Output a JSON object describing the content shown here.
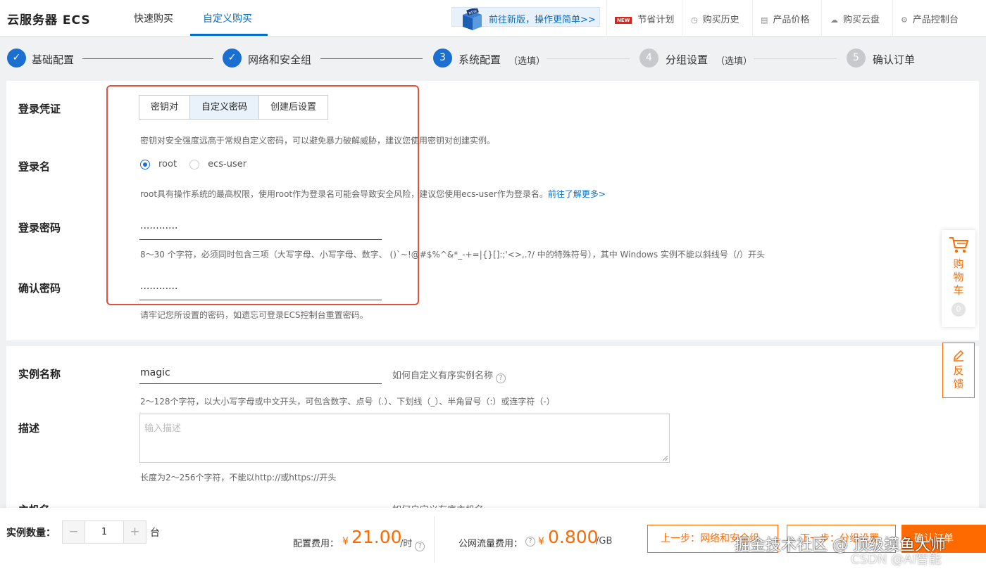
{
  "header": {
    "brand": "云服务器 ECS",
    "tabs": [
      {
        "label": "快速购买"
      },
      {
        "label": "自定义购买"
      }
    ],
    "promo": "前往新版，操作更简单>>",
    "nav": [
      {
        "label": "节省计划",
        "icon": "new-badge-icon",
        "badge": "NEW"
      },
      {
        "label": "购买历史",
        "icon": "clock-icon"
      },
      {
        "label": "产品价格",
        "icon": "document-icon"
      },
      {
        "label": "购买云盘",
        "icon": "cloud-disk-icon"
      },
      {
        "label": "产品控制台",
        "icon": "gear-icon"
      }
    ]
  },
  "steps": [
    {
      "num": "✓",
      "label": "基础配置",
      "optional": "",
      "state": "done"
    },
    {
      "num": "✓",
      "label": "网络和安全组",
      "optional": "",
      "state": "done"
    },
    {
      "num": "3",
      "label": "系统配置",
      "optional": "（选填）",
      "state": "current"
    },
    {
      "num": "4",
      "label": "分组设置",
      "optional": "（选填）",
      "state": "todo"
    },
    {
      "num": "5",
      "label": "确认订单",
      "optional": "",
      "state": "todo"
    }
  ],
  "login": {
    "credential_label": "登录凭证",
    "credential_options": [
      "密钥对",
      "自定义密码",
      "创建后设置"
    ],
    "credential_selected": "自定义密码",
    "credential_hint": "密钥对安全强度远高于常规自定义密码，可以避免暴力破解威胁，建议您使用密钥对创建实例。",
    "username_label": "登录名",
    "username_options": [
      "root",
      "ecs-user"
    ],
    "username_selected": "root",
    "username_hint": "root具有操作系统的最高权限，使用root作为登录名可能会导致安全风险，建议您使用ecs-user作为登录名。",
    "username_link": "前往了解更多>",
    "password_label": "登录密码",
    "password_value": "············",
    "password_hint": "8～30 个字符，必须同时包含三项（大写字母、小写字母、数字、 ()`~!@#$%^&*_-+=|{}[]:;'<>,.?/ 中的特殊符号），其中 Windows 实例不能以斜线号（/）开头",
    "confirm_label": "确认密码",
    "confirm_value": "············",
    "confirm_hint": "请牢记您所设置的密码，如遗忘可登录ECS控制台重置密码。"
  },
  "instance": {
    "name_label": "实例名称",
    "name_value": "magic",
    "name_help": "如何自定义有序实例名称",
    "name_hint": "2～128个字符，以大小写字母或中文开头，可包含数字、点号（.）、下划线（_）、半角冒号（:）或连字符（-）",
    "desc_label": "描述",
    "desc_placeholder": "输入描述",
    "desc_hint": "长度为2～256个字符，不能以http://或https://开头",
    "host_label_partial": "主机名",
    "host_help_partial": "如何自定义有序主机名"
  },
  "side": {
    "cart_chars": [
      "购",
      "物",
      "车"
    ],
    "cart_count": "0",
    "feedback_chars": [
      "反",
      "馈"
    ]
  },
  "footer": {
    "qty_label": "实例数量：",
    "qty_value": "1",
    "qty_minus": "−",
    "qty_plus": "+",
    "qty_unit": "台",
    "config_fee_label": "配置费用：",
    "config_currency": "¥",
    "config_price": "21.00",
    "config_unit": "/时",
    "traffic_fee_label": "公网流量费用：",
    "traffic_currency": "¥",
    "traffic_price": "0.800",
    "traffic_unit": "/GB",
    "prev_button": "上一步：网络和安全组",
    "next_button": "下一步：分组设置",
    "confirm_button": "确认订单",
    "watermark": "掘金技术社区 @ 顶级摸鱼大师",
    "watermark2": "CSDN @AI智能"
  },
  "colors": {
    "accent_blue": "#1a6fd0",
    "accent_orange": "#ff6a00",
    "highlight_red": "#e2513b"
  }
}
